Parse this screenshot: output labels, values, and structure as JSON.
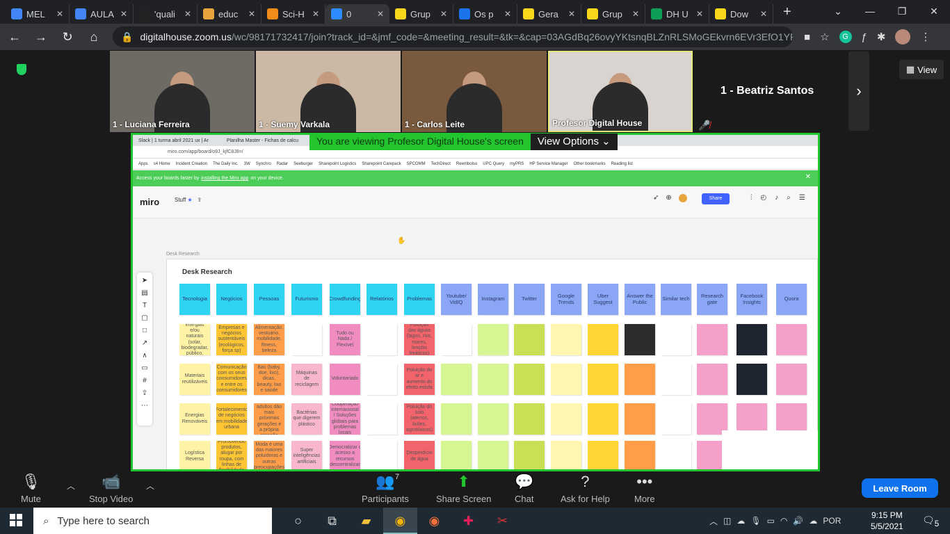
{
  "browser": {
    "tabs": [
      {
        "label": "MEL",
        "color": "#4285f4"
      },
      {
        "label": "AULA",
        "color": "#4285f4"
      },
      {
        "label": "'quali",
        "color": "#222222"
      },
      {
        "label": "educ",
        "color": "#e8a33d"
      },
      {
        "label": "Sci-H",
        "color": "#f08c1a"
      },
      {
        "label": "0",
        "color": "#2d8cff"
      },
      {
        "label": "Grup",
        "color": "#f9d71c"
      },
      {
        "label": "Os p",
        "color": "#1a73e8"
      },
      {
        "label": "Gera",
        "color": "#f9d71c"
      },
      {
        "label": "Grup",
        "color": "#f9d71c"
      },
      {
        "label": "DH U",
        "color": "#0f9d58"
      },
      {
        "label": "Dow",
        "color": "#f9d71c"
      }
    ],
    "url_host": "digitalhouse.zoom.us",
    "url_path": "/wc/98171732417/join?track_id=&jmf_code=&meeting_result=&tk=&cap=03AGdBq26ovyYKtsnqBLZnRLSMoGEkvrn6EVr3EfO1YR..."
  },
  "participants": [
    {
      "name": "1 - Luciana Ferreira",
      "bg": "#6e6a64"
    },
    {
      "name": "1 - Suemy Varkala",
      "bg": "#cbb9a6"
    },
    {
      "name": "1 - Carlos Leite",
      "bg": "#7a5a3e"
    },
    {
      "name": "Profesor Digital House",
      "bg": "#d9d4cf"
    }
  ],
  "active_speaker": "1 - Beatriz Santos",
  "view_label": "View",
  "share_banner": {
    "text": "You are viewing Profesor Digital House's screen",
    "options": "View Options"
  },
  "shared": {
    "tabs": [
      "Slack | 1 turma abril 2021 ux | Ar",
      "Planilha Master - Fichas de calcu",
      "análise de concorrência - YouTu"
    ],
    "url": "miro.com/app/board/o9J_kjfC8J8=/",
    "bookmarks": [
      "Apps",
      "s4 Home",
      "Incident Creation",
      "The Daily Inc.",
      "3W",
      "Synchro",
      "Radar",
      "Seeburger",
      "Sharepoint Logistics",
      "Sharepoint Carepack",
      "SPCOMM",
      "TechDirect",
      "Reembolso",
      "UPC Query",
      "myPRS",
      "HP Service Manager",
      "Other bookmarks",
      "Reading list"
    ],
    "install_prefix": "Access your boards faster by",
    "install_link": "installing the Miro app",
    "install_suffix": "on your device.",
    "logo": "miro",
    "board_name": "Stuff",
    "share_btn": "Share",
    "frame_caption": "Desk Research",
    "frame_title": "Desk Research",
    "columns": [
      {
        "header": "Tecnologia",
        "color": "#2fd4f2",
        "cells": [
          {
            "text": "Diretório de energias e/ou naturais (solar, biodegradar, público, industrial)",
            "color": "#fff3a6"
          },
          {
            "text": "Materiais reutilizáveis",
            "color": "#fff3a6"
          },
          {
            "text": "Energias Renováveis",
            "color": "#fff3a6"
          },
          {
            "text": "Logística Reversa",
            "color": "#fff3a6"
          }
        ]
      },
      {
        "header": "Negócios",
        "color": "#2fd4f2",
        "cells": [
          {
            "text": "Empresas e negócios sustentáveis (ecológicos, força sp)",
            "color": "#ffc533"
          },
          {
            "text": "Comunicação com os seus consumidores e entre os consumidores",
            "color": "#ffc533"
          },
          {
            "text": "Fortalecimento de negócios em mobilidade urbana",
            "color": "#ffc533"
          },
          {
            "text": "Promovendo produtos, alugar por roupa, com linhas de flexibilidade",
            "color": "#ffc533"
          }
        ]
      },
      {
        "header": "Pessoas",
        "color": "#2fd4f2",
        "cells": [
          {
            "text": "Alimentação, vestuário, mobilidade, fitness, beleza",
            "color": "#ff9d48"
          },
          {
            "text": "Baú (baby, doe, lixo), dicas, beauty, lixo e saúde",
            "color": "#ff9d48"
          },
          {
            "text": "Jovens e adultos dão mais próximas gerações e a própria geração",
            "color": "#ff9d48"
          },
          {
            "text": "Moda é uma das maiores poluidoras e outras preocupações",
            "color": "#ff9d48"
          }
        ]
      },
      {
        "header": "Futurismo",
        "color": "#2fd4f2",
        "cells": [
          {
            "text": "",
            "color": "#ffffff"
          },
          {
            "text": "Máquinas de reciclagem",
            "color": "#f8b6cf"
          },
          {
            "text": "Bactérias que digerem plástico",
            "color": "#f8b6cf"
          },
          {
            "text": "Super inteligências artificiais",
            "color": "#f8b6cf"
          }
        ]
      },
      {
        "header": "Crowdfunding",
        "color": "#2fd4f2",
        "cells": [
          {
            "text": "Tudo ou Nada / Flexível",
            "color": "#f08cc0"
          },
          {
            "text": "Voluntariado",
            "color": "#f08cc0"
          },
          {
            "text": "Cooperação internacional / Soluções globais para problemas locais",
            "color": "#f08cc0"
          },
          {
            "text": "Democratizar o acesso a recursos (descentralizar)",
            "color": "#f08cc0"
          }
        ]
      },
      {
        "header": "Relatórios",
        "color": "#2fd4f2",
        "cells": [
          {
            "text": "",
            "color": "#ffffff"
          },
          {
            "text": "",
            "color": "#ffffff"
          },
          {
            "text": "",
            "color": "#ffffff"
          },
          {
            "text": "",
            "color": "#ffffff"
          }
        ]
      },
      {
        "header": "Problemas",
        "color": "#2fd4f2",
        "cells": [
          {
            "text": "Poluição das águas (lagos, rios, mares, lençóis freáticos)",
            "color": "#f2636b"
          },
          {
            "text": "Poluição do ar e aumento do efeito estufa",
            "color": "#f2636b"
          },
          {
            "text": "Poluição do solo (aterros, lixões, agrotóxicos)",
            "color": "#f2636b"
          },
          {
            "text": "Desperdício de água",
            "color": "#f2636b"
          }
        ]
      },
      {
        "header": "Youtube/ VidIQ",
        "color": "#8aa6f5",
        "cells": [
          {
            "text": "",
            "color": "#ffffff"
          },
          {
            "text": "",
            "color": "#d5f692"
          },
          {
            "text": "",
            "color": "#d5f692"
          },
          {
            "text": "",
            "color": "#d5f692"
          }
        ]
      },
      {
        "header": "Instagram",
        "color": "#8aa6f5",
        "cells": [
          {
            "text": "",
            "color": "#d5f692"
          },
          {
            "text": "",
            "color": "#d5f692"
          },
          {
            "text": "",
            "color": "#d5f692"
          },
          {
            "text": "",
            "color": "#d5f692"
          }
        ]
      },
      {
        "header": "Twitter",
        "color": "#8aa6f5",
        "cells": [
          {
            "text": "",
            "color": "#c9df56"
          },
          {
            "text": "",
            "color": "#c9df56"
          },
          {
            "text": "",
            "color": "#c9df56"
          },
          {
            "text": "",
            "color": "#c9df56"
          }
        ]
      },
      {
        "header": "Google Trends",
        "color": "#8aa6f5",
        "cells": [
          {
            "text": "",
            "color": "#fff6b0"
          },
          {
            "text": "",
            "color": "#fff6b0"
          },
          {
            "text": "",
            "color": "#fff6b0"
          },
          {
            "text": "",
            "color": "#fff6b0"
          }
        ]
      },
      {
        "header": "Uber Suggest",
        "color": "#8aa6f5",
        "cells": [
          {
            "text": "",
            "color": "#ffd633"
          },
          {
            "text": "",
            "color": "#ffd633"
          },
          {
            "text": "",
            "color": "#ffd633"
          },
          {
            "text": "",
            "color": "#ffd633"
          }
        ]
      },
      {
        "header": "Answer the Public",
        "color": "#8aa6f5",
        "cells": [
          {
            "text": "",
            "color": "#2c2c2c"
          },
          {
            "text": "",
            "color": "#ff9d48"
          },
          {
            "text": "",
            "color": "#ff9d48"
          },
          {
            "text": "",
            "color": "#ff9d48"
          }
        ]
      },
      {
        "header": "Similar tech",
        "color": "#8aa6f5",
        "cells": [
          {
            "text": "",
            "color": "#ffffff"
          },
          {
            "text": "",
            "color": "#ffffff"
          },
          {
            "text": "",
            "color": "#ffffff"
          },
          {
            "text": "",
            "color": "#ffffff"
          }
        ]
      },
      {
        "header": "Research gate",
        "color": "#8aa6f5",
        "cells": [
          {
            "text": "",
            "color": "#f59fcb"
          },
          {
            "text": "",
            "color": "#f59fcb"
          },
          {
            "text": "",
            "color": "#f59fcb"
          },
          {
            "text": "",
            "color": "#f59fcb"
          }
        ]
      },
      {
        "header": "Facebook Insights",
        "color": "#8aa6f5",
        "cells": [
          {
            "text": "",
            "color": "#1e2430"
          },
          {
            "text": "",
            "color": "#1e2430"
          },
          {
            "text": "",
            "color": "#f59fcb"
          },
          {
            "text": "",
            "color": "#ffffff"
          }
        ]
      },
      {
        "header": "Quora",
        "color": "#8aa6f5",
        "cells": [
          {
            "text": "",
            "color": "#f59fcb"
          },
          {
            "text": "",
            "color": "#f59fcb"
          },
          {
            "text": "",
            "color": "#f59fcb"
          },
          {
            "text": "",
            "color": "#ffffff"
          }
        ]
      }
    ]
  },
  "zoom_controls": {
    "mute": "Mute",
    "stop_video": "Stop Video",
    "participants": "Participants",
    "participants_count": "7",
    "share_screen": "Share Screen",
    "chat": "Chat",
    "ask_for_help": "Ask for Help",
    "more": "More",
    "leave": "Leave Room"
  },
  "taskbar": {
    "search_placeholder": "Type here to search",
    "lang": "POR",
    "time": "9:15 PM",
    "date": "5/5/2021",
    "notifications": "5"
  }
}
